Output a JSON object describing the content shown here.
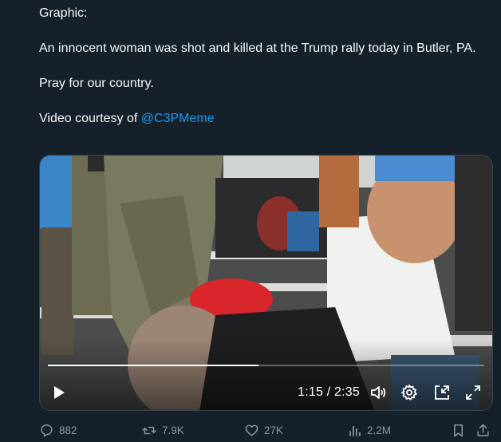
{
  "tweet": {
    "paragraphs": [
      "Graphic:",
      "An innocent woman was shot and killed at the Trump rally today in Butler, PA.",
      "Pray for our country."
    ],
    "credit_prefix": "Video courtesy of ",
    "credit_mention": "@C3PMeme"
  },
  "video": {
    "time_display": "1:15 / 2:35",
    "progress_fraction": 0.482,
    "icons": {
      "play": "play-icon",
      "volume": "volume-icon",
      "settings": "gear-icon",
      "pip": "picture-in-picture-icon",
      "fullscreen": "fullscreen-icon"
    }
  },
  "actions": {
    "replies": "882",
    "reposts": "7.9K",
    "likes": "27K",
    "views": "2.2M"
  },
  "colors": {
    "background": "#15202b",
    "text": "#f7f9f9",
    "mention": "#1d9bf0",
    "muted": "#8b98a5"
  }
}
